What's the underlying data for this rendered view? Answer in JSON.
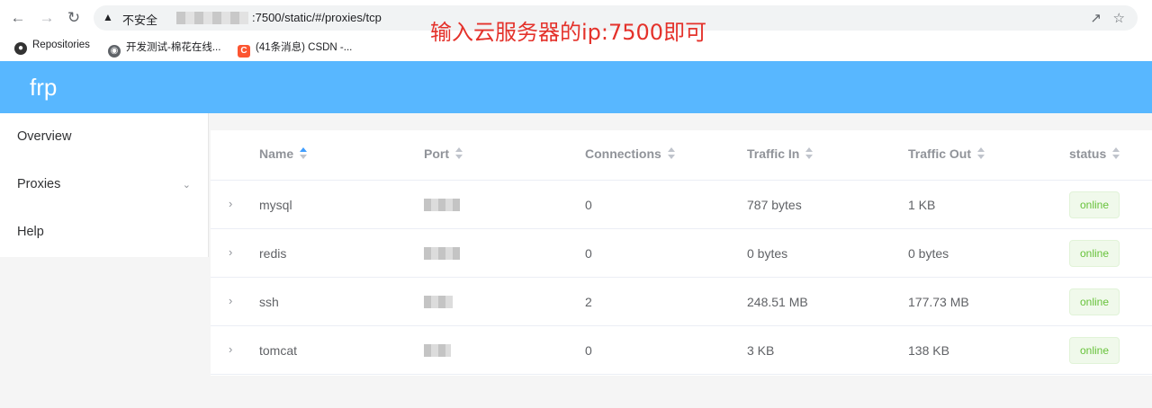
{
  "browser": {
    "warning_icon": "warning-triangle-icon",
    "insecure_label": "不安全",
    "url_visible": ":7500/static/#/proxies/tcp",
    "annotation": "输入云服务器的ip:7500即可",
    "bookmarks": [
      {
        "label": "Repositories",
        "icon": "github-icon"
      },
      {
        "label": "开发测试-棉花在线...",
        "icon": "globe-icon"
      },
      {
        "label": "(41条消息) CSDN -...",
        "icon": "csdn-icon"
      }
    ]
  },
  "app": {
    "brand": "frp",
    "header_color": "#58b7ff"
  },
  "sidebar": {
    "items": [
      {
        "label": "Overview"
      },
      {
        "label": "Proxies"
      },
      {
        "label": "Help"
      }
    ]
  },
  "table": {
    "columns": [
      "Name",
      "Port",
      "Connections",
      "Traffic In",
      "Traffic Out",
      "status"
    ],
    "rows": [
      {
        "name": "mysql",
        "connections": "0",
        "traffic_in": "787 bytes",
        "traffic_out": "1 KB",
        "status": "online"
      },
      {
        "name": "redis",
        "connections": "0",
        "traffic_in": "0 bytes",
        "traffic_out": "0 bytes",
        "status": "online"
      },
      {
        "name": "ssh",
        "connections": "2",
        "traffic_in": "248.51 MB",
        "traffic_out": "177.73 MB",
        "status": "online"
      },
      {
        "name": "tomcat",
        "connections": "0",
        "traffic_in": "3 KB",
        "traffic_out": "138 KB",
        "status": "online"
      }
    ]
  }
}
